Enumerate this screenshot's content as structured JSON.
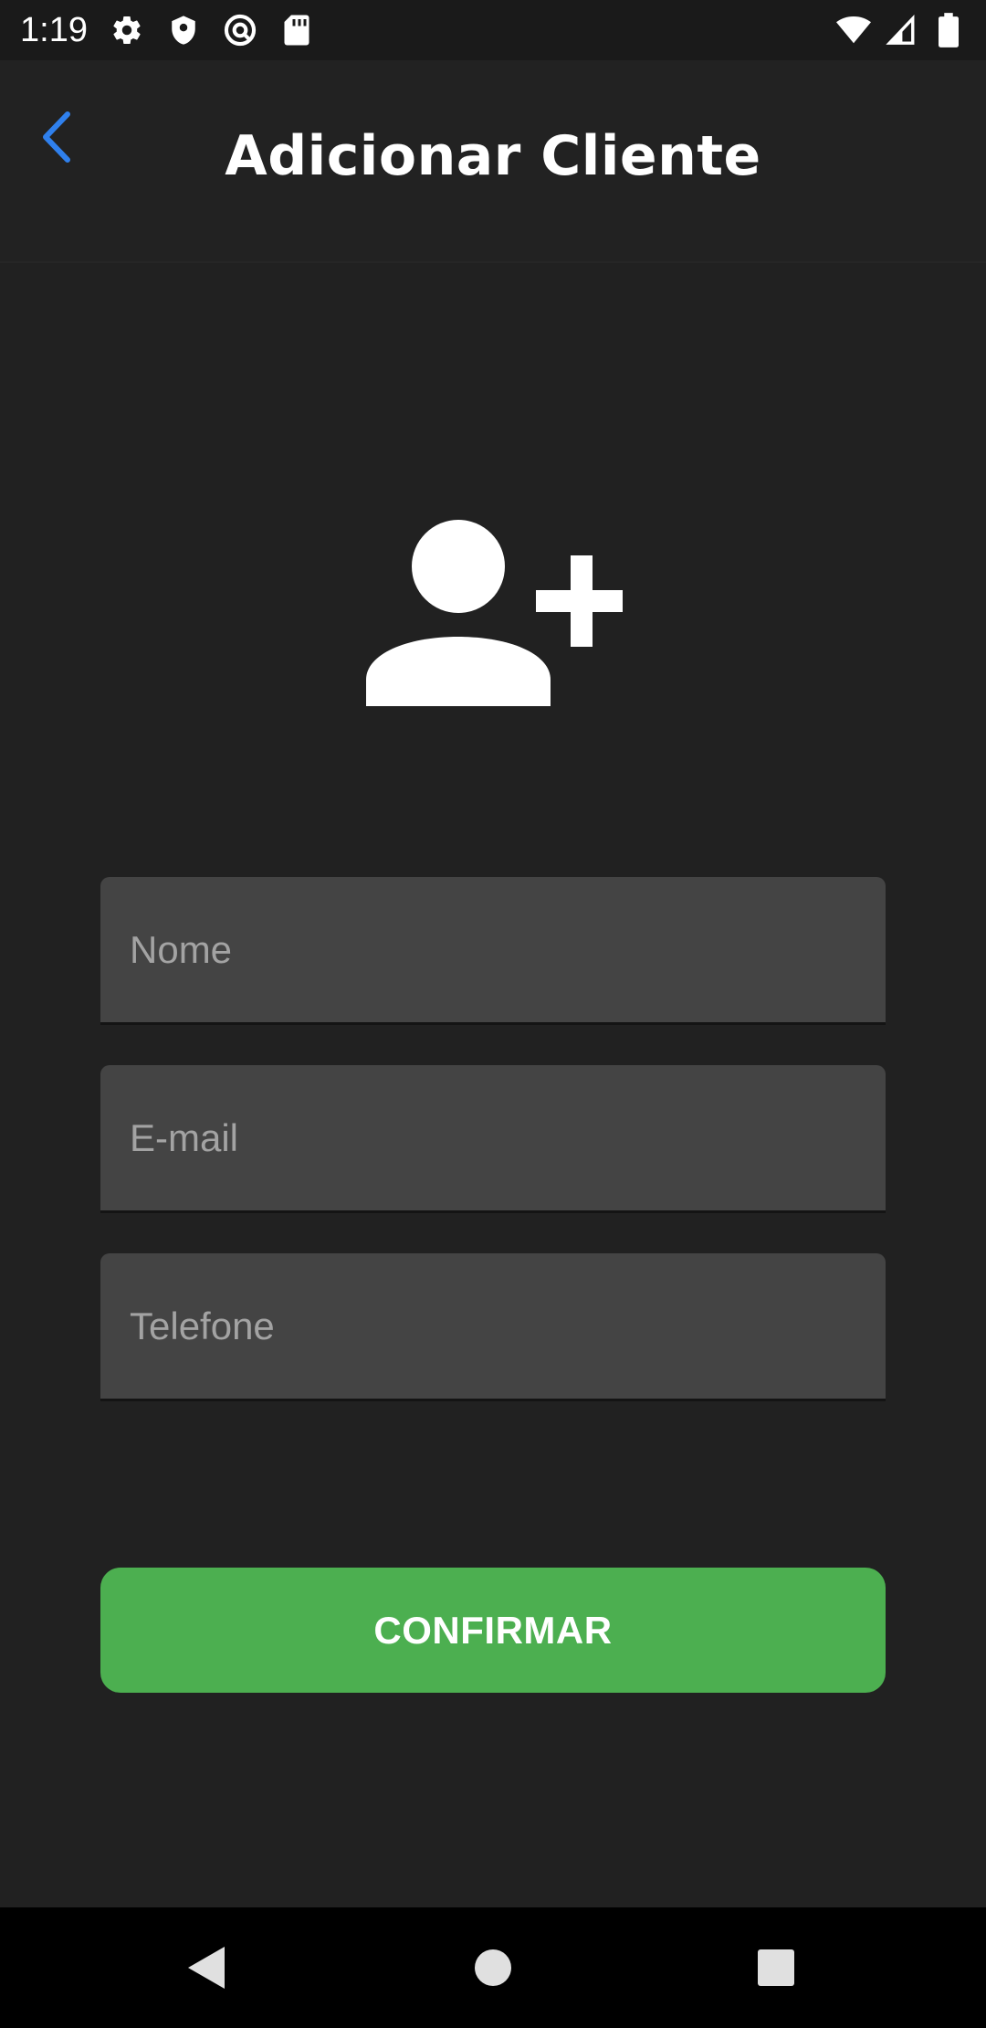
{
  "status_bar": {
    "time": "1:19",
    "left_icons": [
      "gear-icon",
      "shield-icon",
      "at-sign-icon",
      "sd-card-icon"
    ],
    "right_icons": [
      "wifi-icon",
      "cell-signal-icon",
      "battery-icon"
    ]
  },
  "app_bar": {
    "back_icon": "chevron-left-icon",
    "title": "Adicionar Cliente"
  },
  "hero": {
    "icon": "add-user-icon"
  },
  "form": {
    "nome": {
      "placeholder": "Nome",
      "value": ""
    },
    "email": {
      "placeholder": "E-mail",
      "value": ""
    },
    "telefone": {
      "placeholder": "Telefone",
      "value": ""
    }
  },
  "confirm_label": "CONFIRMAR",
  "nav_bar": {
    "icons": [
      "nav-back-icon",
      "nav-home-icon",
      "nav-recents-icon"
    ]
  },
  "colors": {
    "background": "#212121",
    "input_background": "#444444",
    "accent_blue": "#2f80ed",
    "confirm_green": "#4caf50"
  }
}
